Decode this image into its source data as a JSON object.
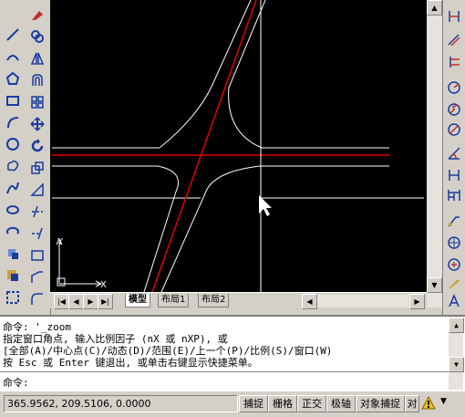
{
  "colors": {
    "canvas_bg": "#000000",
    "road": "#ffffff",
    "centerline": "#e00000",
    "ui_bg": "#d4d0c8"
  },
  "left_toolbar_1": [
    "line-icon",
    "construction-line-icon",
    "polyline-icon",
    "polygon-icon",
    "rectangle-icon",
    "arc-icon",
    "circle-icon",
    "revision-cloud-icon",
    "spline-icon",
    "ellipse-icon",
    "ellipse-arc-icon",
    "insert-block-icon",
    "make-block-icon",
    "point-icon",
    "hatch-icon"
  ],
  "left_toolbar_2": [
    "erase-icon",
    "copy-icon",
    "mirror-icon",
    "offset-icon",
    "array-icon",
    "move-icon",
    "rotate-icon",
    "scale-icon",
    "stretch-icon",
    "trim-icon",
    "extend-icon",
    "break-icon",
    "join-icon",
    "chamfer-icon",
    "fillet-icon"
  ],
  "right_toolbar": [
    "linear-dimension-icon",
    "aligned-dimension-icon",
    "ordinate-icon",
    "radius-icon",
    "jogged-icon",
    "diameter-icon",
    "angular-icon",
    "quick-dim-icon",
    "baseline-icon",
    "continue-icon",
    "leader-icon",
    "tolerance-icon",
    "center-mark-icon",
    "dimedit-icon",
    "dimtedit-icon"
  ],
  "ucs": {
    "x_label": "X",
    "y_label": "Y"
  },
  "tabs": {
    "model": "模型",
    "layout1": "布局1",
    "layout2": "布局2"
  },
  "command": {
    "line1": "命令: '_zoom",
    "line2": "指定窗口角点, 输入比例因子 (nX 或 nXP), 或",
    "line3": "[全部(A)/中心点(C)/动态(D)/范围(E)/上一个(P)/比例(S)/窗口(W)",
    "line4": "按 Esc 或 Enter 键退出, 或单击右键显示快捷菜单。",
    "prompt": "命令:"
  },
  "status": {
    "coords": "365.9562, 209.5106, 0.0000",
    "snap": "捕捉",
    "grid": "栅格",
    "ortho": "正交",
    "polar": "极轴",
    "osnap": "对象捕捉",
    "otrack": "对"
  }
}
